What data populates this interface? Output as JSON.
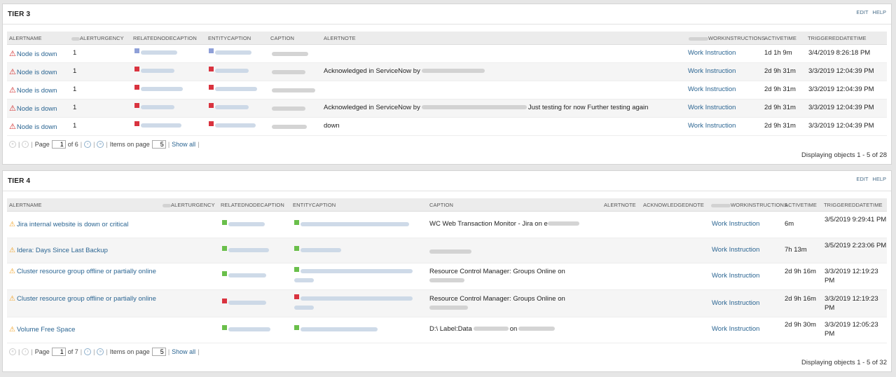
{
  "tier3": {
    "title": "TIER 3",
    "edit": "EDIT",
    "help": "HELP",
    "headers": [
      "ALERTNAME",
      "ALERTURGENCY",
      "RELATEDNODECAPTION",
      "ENTITYCAPTION",
      "CAPTION",
      "ALERTNOTE",
      "WORKINSTRUCTIONS",
      "ACTIVETIME",
      "TRIGGEREDDATETIME"
    ],
    "rows": [
      {
        "alertname": "Node is down",
        "urgency": "1",
        "note_a": "",
        "note_b": "",
        "work": "Work Instruction",
        "active": "1d 1h 9m",
        "triggered": "3/4/2019 8:26:18 PM"
      },
      {
        "alertname": "Node is down",
        "urgency": "1",
        "note_a": "Acknowledged in ServiceNow by",
        "note_b": "",
        "work": "Work Instruction",
        "active": "2d 9h 31m",
        "triggered": "3/3/2019 12:04:39 PM"
      },
      {
        "alertname": "Node is down",
        "urgency": "1",
        "note_a": "",
        "note_b": "",
        "work": "Work Instruction",
        "active": "2d 9h 31m",
        "triggered": "3/3/2019 12:04:39 PM"
      },
      {
        "alertname": "Node is down",
        "urgency": "1",
        "note_a": "Acknowledged in ServiceNow by",
        "note_b": "Just testing for now Further testing again",
        "work": "Work Instruction",
        "active": "2d 9h 31m",
        "triggered": "3/3/2019 12:04:39 PM"
      },
      {
        "alertname": "Node is down",
        "urgency": "1",
        "note_a": "down",
        "note_b": "",
        "work": "Work Instruction",
        "active": "2d 9h 31m",
        "triggered": "3/3/2019 12:04:39 PM"
      }
    ],
    "pager": {
      "page_label": "Page",
      "page_value": "1",
      "of_label": "of 6",
      "items_label": "Items on page",
      "items_value": "5",
      "show_all": "Show all"
    },
    "display": "Displaying objects 1 - 5 of 28"
  },
  "tier4": {
    "title": "TIER 4",
    "edit": "EDIT",
    "help": "HELP",
    "headers": [
      "ALERTNAME",
      "ALERTURGENCY",
      "RELATEDNODECAPTION",
      "ENTITYCAPTION",
      "CAPTION",
      "ALERTNOTE",
      "ACKNOWLEDGEDNOTE",
      "WORKINSTRUCTIONS",
      "ACTIVETIME",
      "TRIGGEREDDATETIME"
    ],
    "rows": [
      {
        "alertname": "Jira internal website is down or critical",
        "caption": "WC Web Transaction Monitor - Jira on e",
        "work": "Work Instruction",
        "active": "6m",
        "triggered": "3/5/2019 9:29:41 PM"
      },
      {
        "alertname": "Idera: Days Since Last Backup",
        "caption": "",
        "work": "Work Instruction",
        "active": "7h 13m",
        "triggered": "3/5/2019 2:23:06 PM"
      },
      {
        "alertname": "Cluster resource group offline or partially online",
        "caption": "Resource Control Manager: Groups Online on",
        "work": "Work Instruction",
        "active": "2d 9h 16m",
        "triggered": "3/3/2019 12:19:23 PM"
      },
      {
        "alertname": "Cluster resource group offline or partially online",
        "caption": "Resource Control Manager: Groups Online on",
        "work": "Work Instruction",
        "active": "2d 9h 16m",
        "triggered": "3/3/2019 12:19:23 PM"
      },
      {
        "alertname": "Volume Free Space",
        "caption": "D:\\ Label:Data",
        "caption_b": "on",
        "work": "Work Instruction",
        "active": "2d 9h 30m",
        "triggered": "3/3/2019 12:05:23 PM"
      }
    ],
    "pager": {
      "page_label": "Page",
      "page_value": "1",
      "of_label": "of 7",
      "items_label": "Items on page",
      "items_value": "5",
      "show_all": "Show all"
    },
    "display": "Displaying objects 1 - 5 of 32"
  },
  "icons": {
    "warning_red": "warning-triangle-red-icon",
    "warning_orange": "warning-triangle-orange-icon",
    "first": "first-page-icon",
    "prev": "prev-page-icon",
    "next": "next-page-icon",
    "last": "last-page-icon"
  },
  "colors": {
    "link": "#2b6592",
    "down": "#d9333f",
    "up": "#6abf4b",
    "warn": "#f0a020"
  }
}
